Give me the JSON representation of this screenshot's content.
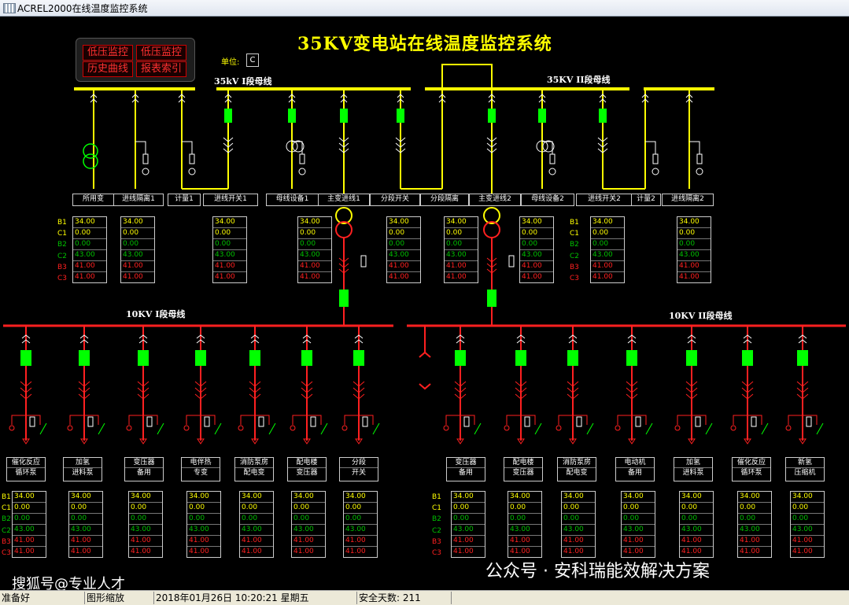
{
  "window": {
    "title": "ACREL2000在线温度监控系统"
  },
  "main_title": "35KV变电站在线温度监控系统",
  "buttons": [
    "低压监控",
    "低压监控",
    "历史曲线",
    "报表索引"
  ],
  "unit": {
    "label": "单位:",
    "value": "C"
  },
  "bus_labels": {
    "bus35_1": "35kV I段母线",
    "bus35_2": "35KV II段母线",
    "bus10_1": "10KV I段母线",
    "bus10_2": "10KV II段母线"
  },
  "top_feeders": [
    "所用变",
    "进线隔离1",
    "计量1",
    "进线开关1",
    "母线设备1",
    "主变进线1",
    "分段开关",
    "分段隔离",
    "主变进线2",
    "母线设备2",
    "进线开关2",
    "计量2",
    "进线隔离2"
  ],
  "bottom_feeders_left": [
    [
      "催化反应",
      "循环泵"
    ],
    [
      "加氢",
      "进料泵"
    ],
    [
      "变压器",
      "备用"
    ],
    [
      "电伴热",
      "专变"
    ],
    [
      "消防泵房",
      "配电变"
    ],
    [
      "配电楼",
      "变压器"
    ],
    [
      "分段",
      "开关"
    ]
  ],
  "bottom_feeders_right": [
    [
      "变压器",
      "备用"
    ],
    [
      "配电楼",
      "变压器"
    ],
    [
      "消防泵房",
      "配电变"
    ],
    [
      "电动机",
      "备用"
    ],
    [
      "加氢",
      "进料泵"
    ],
    [
      "催化反应",
      "循环泵"
    ],
    [
      "新氢",
      "压缩机"
    ]
  ],
  "row_labels": [
    "B1",
    "C1",
    "B2",
    "C2",
    "B3",
    "C3"
  ],
  "row_label_colors": [
    "#ffff00",
    "#ffff00",
    "#00c000",
    "#00c000",
    "#ff2020",
    "#ff2020"
  ],
  "reading_values": [
    "34.00",
    "0.00",
    "0.00",
    "43.00",
    "41.00",
    "41.00"
  ],
  "colors": {
    "bus35": "#ffff00",
    "bus10": "#ff2020",
    "breaker": "#00ff00",
    "feeder_line": "#ffff00"
  },
  "status": {
    "ready": "准备好",
    "mode": "图形缩放",
    "datetime": "2018年01月26日   10:20:21   星期五",
    "safe_days": "安全天数: 211"
  },
  "watermarks": [
    "搜狐号@专业人才",
    "公众号 · 安科瑞能效解决方案"
  ]
}
